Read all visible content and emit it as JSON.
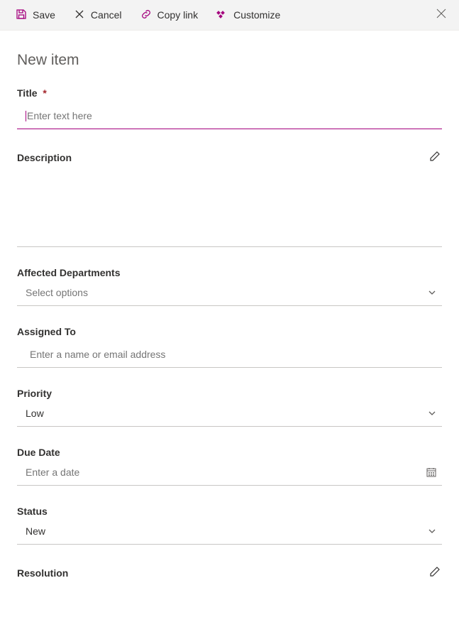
{
  "toolbar": {
    "save_label": "Save",
    "cancel_label": "Cancel",
    "copy_link_label": "Copy link",
    "customize_label": "Customize"
  },
  "page": {
    "title": "New item"
  },
  "fields": {
    "title": {
      "label": "Title",
      "required_mark": "*",
      "placeholder": "Enter text here",
      "value": ""
    },
    "description": {
      "label": "Description"
    },
    "affected_departments": {
      "label": "Affected Departments",
      "placeholder": "Select options"
    },
    "assigned_to": {
      "label": "Assigned To",
      "placeholder": "Enter a name or email address"
    },
    "priority": {
      "label": "Priority",
      "value": "Low"
    },
    "due_date": {
      "label": "Due Date",
      "placeholder": "Enter a date"
    },
    "status": {
      "label": "Status",
      "value": "New"
    },
    "resolution": {
      "label": "Resolution"
    }
  },
  "colors": {
    "accent": "#a4007d"
  }
}
